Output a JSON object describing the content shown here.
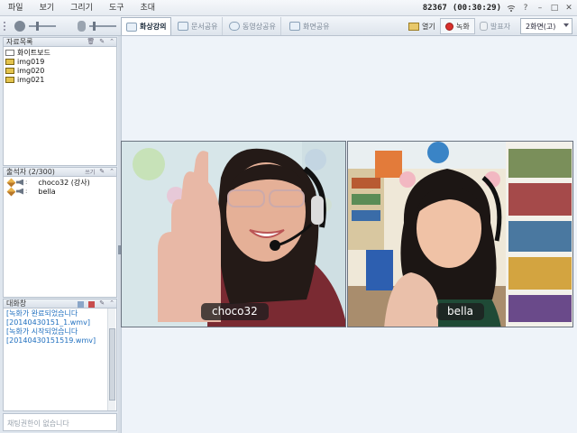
{
  "menu": [
    "파일",
    "보기",
    "그리기",
    "도구",
    "초대"
  ],
  "session": {
    "id": "82367",
    "time": "(00:30:29)"
  },
  "toolbar": {
    "tabs": [
      {
        "label": "화상강의",
        "icon": "camera-icon",
        "active": true
      },
      {
        "label": "문서공유",
        "icon": "document-icon",
        "active": false
      },
      {
        "label": "동영상공유",
        "icon": "video-share-icon",
        "active": false
      },
      {
        "label": "화면공유",
        "icon": "screen-share-icon",
        "active": false
      }
    ],
    "open_label": "열기",
    "record_label": "녹화",
    "presenter_label": "발표자",
    "screen_mode": "2화면(고)"
  },
  "files_panel": {
    "title": "자료목록",
    "items": [
      "화이트보드",
      "img019",
      "img020",
      "img021"
    ]
  },
  "attendees_panel": {
    "title": "출석자 (2/300)",
    "sort_label": "쓰기",
    "items": [
      "choco32 (강사)",
      "bella"
    ]
  },
  "chat_panel": {
    "title": "대화창",
    "lines": [
      "[녹화가 완료되었습니다",
      "[20140430151_1.wmv]",
      "[녹화가 시작되었습니다",
      "[20140430151519.wmv]"
    ],
    "input_placeholder": "채팅권한이 없습니다"
  },
  "videos": [
    {
      "name": "choco32"
    },
    {
      "name": "bella"
    }
  ],
  "colors": {
    "accent": "#1f6fbf",
    "record": "#d8302c"
  }
}
